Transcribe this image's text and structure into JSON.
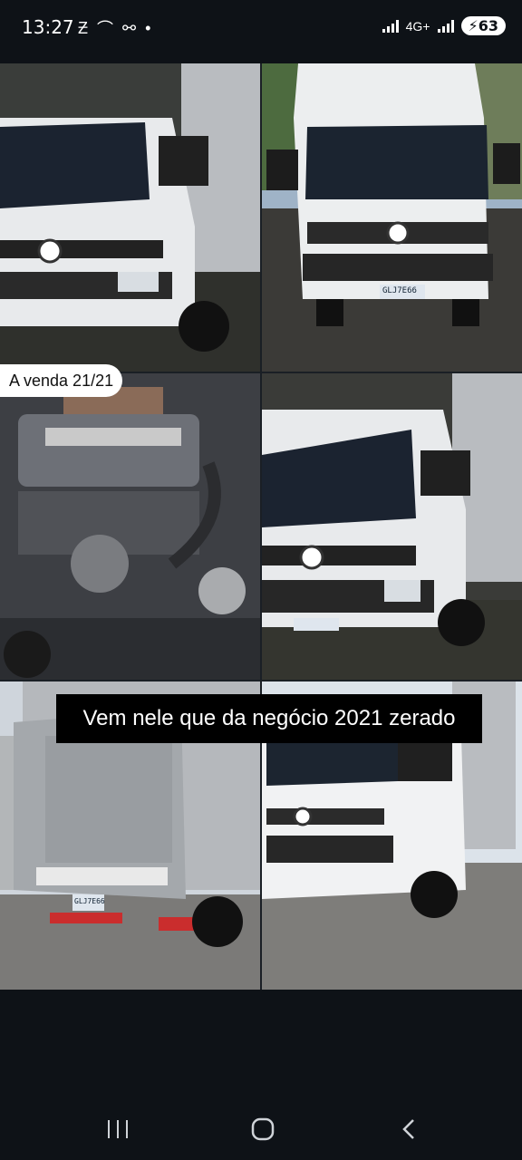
{
  "status_bar": {
    "time": "13:27",
    "network_label": "4G+",
    "battery": "63"
  },
  "story": {
    "caption_top": "A venda 21/21",
    "caption_main": "Vem nele que da negócio 2021 zerado"
  },
  "photos": [
    {
      "name": "truck-front-left"
    },
    {
      "name": "truck-front"
    },
    {
      "name": "engine-bay"
    },
    {
      "name": "truck-front-left-2"
    },
    {
      "name": "truck-rear-liftgate"
    },
    {
      "name": "truck-front-right"
    }
  ],
  "plates": {
    "front": "GLJ7E66",
    "rear": "GLJ7E66"
  },
  "navigation": {
    "recents": "recents-icon",
    "home": "home-icon",
    "back": "back-icon"
  },
  "colors": {
    "background": "#0e1217",
    "caption_bg": "#000000",
    "caption_text": "#ffffff"
  }
}
